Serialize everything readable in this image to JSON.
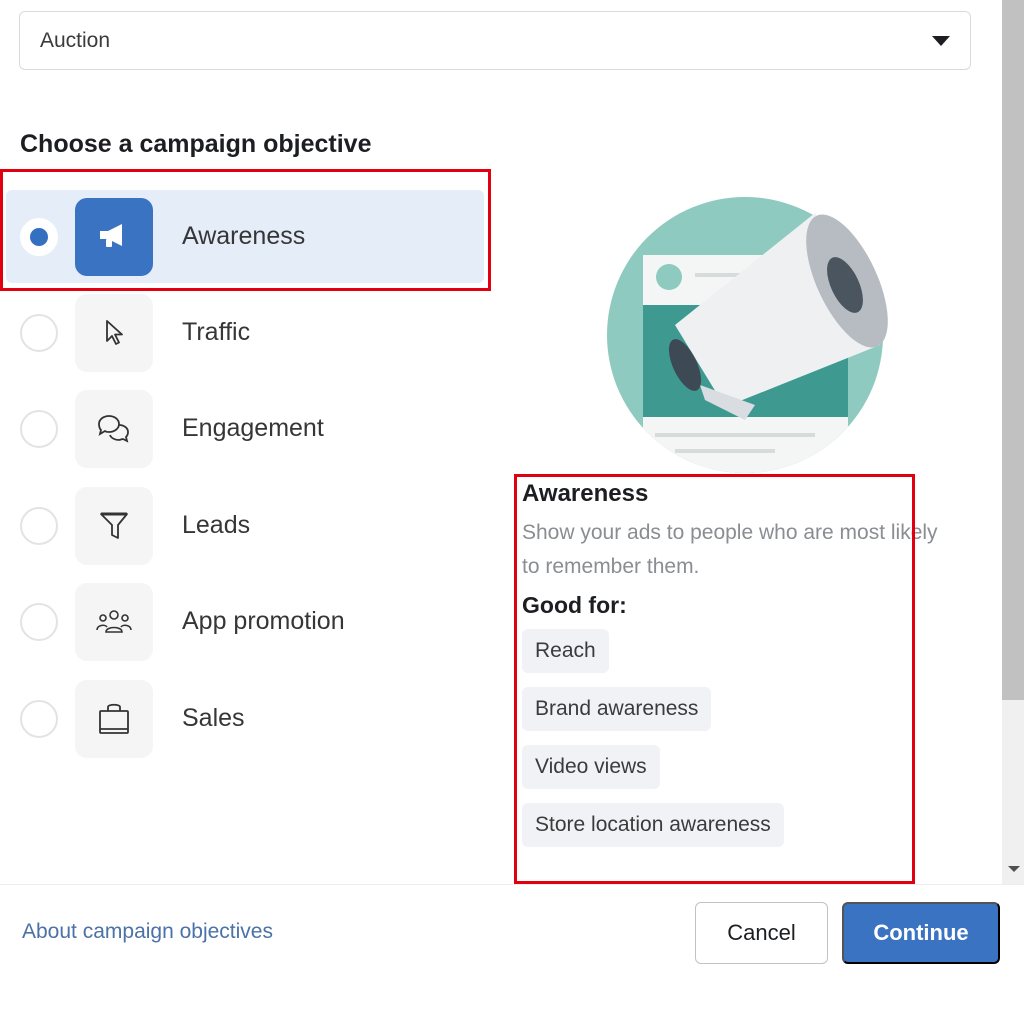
{
  "bid_strategy": {
    "selected": "Auction"
  },
  "heading": "Choose a campaign objective",
  "objectives": [
    {
      "label": "Awareness",
      "icon": "megaphone-icon",
      "selected": true
    },
    {
      "label": "Traffic",
      "icon": "cursor-icon",
      "selected": false
    },
    {
      "label": "Engagement",
      "icon": "chat-bubbles-icon",
      "selected": false
    },
    {
      "label": "Leads",
      "icon": "funnel-icon",
      "selected": false
    },
    {
      "label": "App promotion",
      "icon": "people-group-icon",
      "selected": false
    },
    {
      "label": "Sales",
      "icon": "shopping-bag-icon",
      "selected": false
    }
  ],
  "detail": {
    "illustration": "megaphone-illustration",
    "title": "Awareness",
    "description": "Show your ads to people who are most likely to remember them.",
    "good_for_label": "Good for:",
    "good_for": [
      "Reach",
      "Brand awareness",
      "Video views",
      "Store location awareness"
    ]
  },
  "footer": {
    "link": "About campaign objectives",
    "cancel": "Cancel",
    "continue": "Continue"
  },
  "colors": {
    "accent": "#3a73c2",
    "selected_bg": "#e5edf8",
    "highlight": "#e0000f"
  }
}
